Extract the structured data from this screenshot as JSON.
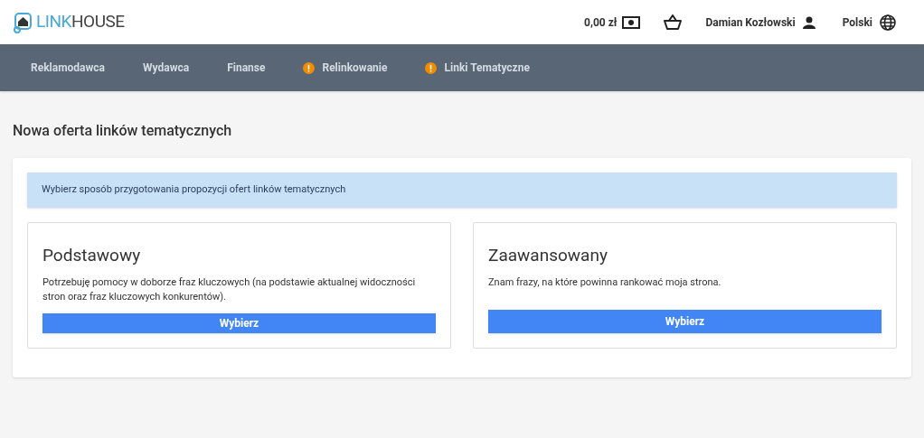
{
  "header": {
    "logo": {
      "part_1": "LINK",
      "part_2": "HOUSE"
    },
    "balance": "0,00 zł",
    "user": "Damian Kozłowski",
    "language": "Polski"
  },
  "nav": [
    {
      "label": "Reklamodawca",
      "alert": false
    },
    {
      "label": "Wydawca",
      "alert": false
    },
    {
      "label": "Finanse",
      "alert": false
    },
    {
      "label": "Relinkowanie",
      "alert": true
    },
    {
      "label": "Linki Tematyczne",
      "alert": true
    }
  ],
  "page_title": "Nowa oferta linków tematycznych",
  "info": "Wybierz sposób przygotowania propozycji ofert linków tematycznych",
  "options": [
    {
      "title": "Podstawowy",
      "description": "Potrzebuję pomocy w doborze fraz kluczowych (na podstawie aktualnej widoczności stron oraz fraz kluczowych konkurentów).",
      "button": "Wybierz"
    },
    {
      "title": "Zaawansowany",
      "description": "Znam frazy, na które powinna rankować moja strona.",
      "button": "Wybierz"
    }
  ]
}
